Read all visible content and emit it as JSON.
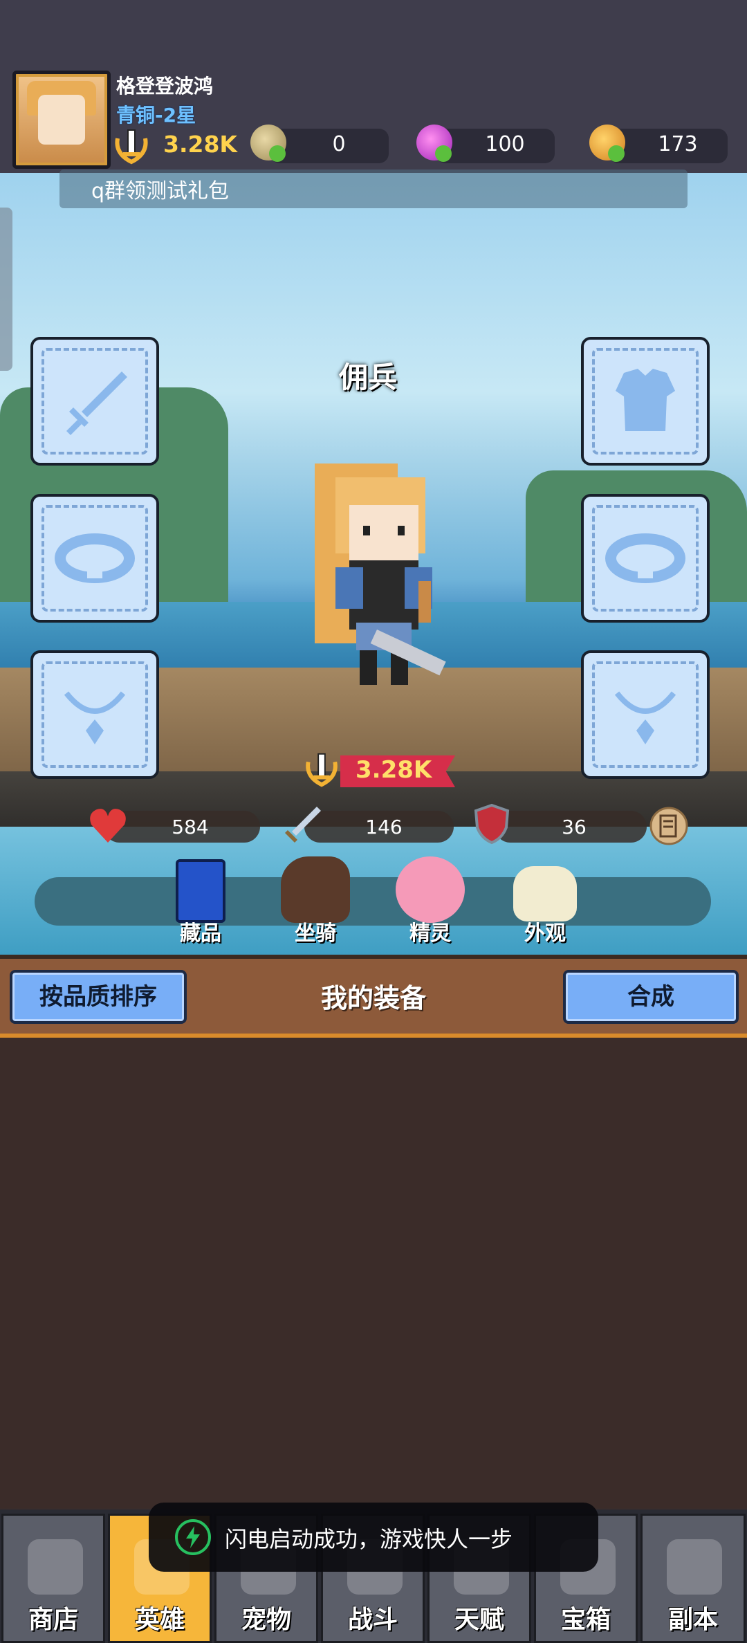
{
  "player": {
    "name": "格登登波鸿",
    "rank": "青铜-2星",
    "power": "3.28K"
  },
  "resources": [
    {
      "icon": "egg-add-icon",
      "value": "0"
    },
    {
      "icon": "gem-add-icon",
      "value": "100"
    },
    {
      "icon": "coin-add-icon",
      "value": "173"
    }
  ],
  "banner": {
    "text": "q群领测试礼包"
  },
  "scene": {
    "title": "佣兵",
    "slots_left": [
      "sword-icon",
      "ring-icon",
      "necklace-icon"
    ],
    "slots_right": [
      "armor-icon",
      "ring-icon",
      "necklace-icon"
    ],
    "hero_power": "3.28K"
  },
  "stats": {
    "hp": "584",
    "attack": "146",
    "defense": "36"
  },
  "tabs": [
    {
      "label": "藏品",
      "icon": "collection-card-icon"
    },
    {
      "label": "坐骑",
      "icon": "horse-mount-icon"
    },
    {
      "label": "精灵",
      "icon": "pink-spirit-icon"
    },
    {
      "label": "外观",
      "icon": "outfit-icon"
    }
  ],
  "equipment": {
    "sort_label": "按品质排序",
    "title": "我的装备",
    "merge_label": "合成"
  },
  "toast": {
    "text": "闪电启动成功，游戏快人一步"
  },
  "nav": [
    {
      "label": "商店",
      "icon": "shop-icon",
      "active": false
    },
    {
      "label": "英雄",
      "icon": "hero-icon",
      "active": true
    },
    {
      "label": "宠物",
      "icon": "pet-icon",
      "active": false
    },
    {
      "label": "战斗",
      "icon": "battle-icon",
      "active": false
    },
    {
      "label": "天赋",
      "icon": "talent-icon",
      "active": false
    },
    {
      "label": "宝箱",
      "icon": "chest-icon",
      "active": false
    },
    {
      "label": "副本",
      "icon": "dungeon-map-icon",
      "active": false
    }
  ],
  "colors": {
    "slot_bg": "#cde4fb",
    "slot_icon": "#8ab8ec",
    "power_gold": "#ffd34d",
    "rank_blue": "#6ec1ff",
    "ribbon_red": "#d62e4a",
    "nav_active": "#f6b63a",
    "button_blue": "#78aef7"
  }
}
